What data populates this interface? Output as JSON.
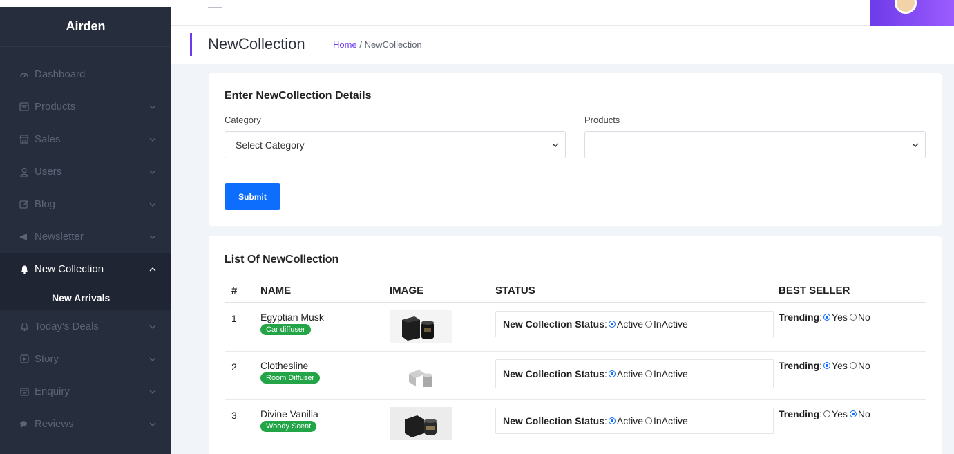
{
  "sidebar": {
    "brand": "Airden",
    "items": [
      {
        "label": "Dashboard",
        "icon": "cloud-gauge-icon",
        "chevron": ""
      },
      {
        "label": "Products",
        "icon": "box-icon",
        "chevron": "⌵"
      },
      {
        "label": "Sales",
        "icon": "store-icon",
        "chevron": "⌵"
      },
      {
        "label": "Users",
        "icon": "user-icon",
        "chevron": "⌵"
      },
      {
        "label": "Blog",
        "icon": "edit-icon",
        "chevron": "⌵"
      },
      {
        "label": "Newsletter",
        "icon": "megaphone-icon",
        "chevron": "⌵"
      },
      {
        "label": "New Collection",
        "icon": "bell-icon",
        "chevron": "^"
      },
      {
        "label": "Today's Deals",
        "icon": "bell-outline-icon",
        "chevron": "⌵"
      },
      {
        "label": "Story",
        "icon": "play-box-icon",
        "chevron": "⌵"
      },
      {
        "label": "Enquiry",
        "icon": "calendar-icon",
        "chevron": "⌵"
      },
      {
        "label": "Reviews",
        "icon": "chat-icon",
        "chevron": "⌵"
      }
    ],
    "sub_item": "New Arrivals"
  },
  "header": {
    "title": "NewCollection",
    "breadcrumb_home": "Home",
    "breadcrumb_sep": "/",
    "breadcrumb_current": "NewCollection"
  },
  "form": {
    "title": "Enter NewCollection Details",
    "category_label": "Category",
    "category_value": "Select Category",
    "products_label": "Products",
    "products_value": "",
    "submit_label": "Submit"
  },
  "list": {
    "title": "List Of NewCollection",
    "columns": [
      "#",
      "NAME",
      "IMAGE",
      "STATUS",
      "BEST SELLER"
    ],
    "status_label": "New Collection Status",
    "status_options": [
      "Active",
      "InActive"
    ],
    "trending_label": "Trending",
    "trending_options": [
      "Yes",
      "No"
    ],
    "rows": [
      {
        "num": "1",
        "name": "Egyptian Musk",
        "tag": "Car diffuser",
        "status": "Active",
        "trending": "Yes"
      },
      {
        "num": "2",
        "name": "Clothesline",
        "tag": "Room Diffuser",
        "status": "Active",
        "trending": "Yes"
      },
      {
        "num": "3",
        "name": "Divine Vanilla",
        "tag": "Woody Scent",
        "status": "Active",
        "trending": "No"
      }
    ]
  },
  "colors": {
    "accent": "#6c3bf0",
    "primary_button": "#0d6efd",
    "badge_green": "#22a447",
    "sidebar_bg": "#262d3c"
  }
}
